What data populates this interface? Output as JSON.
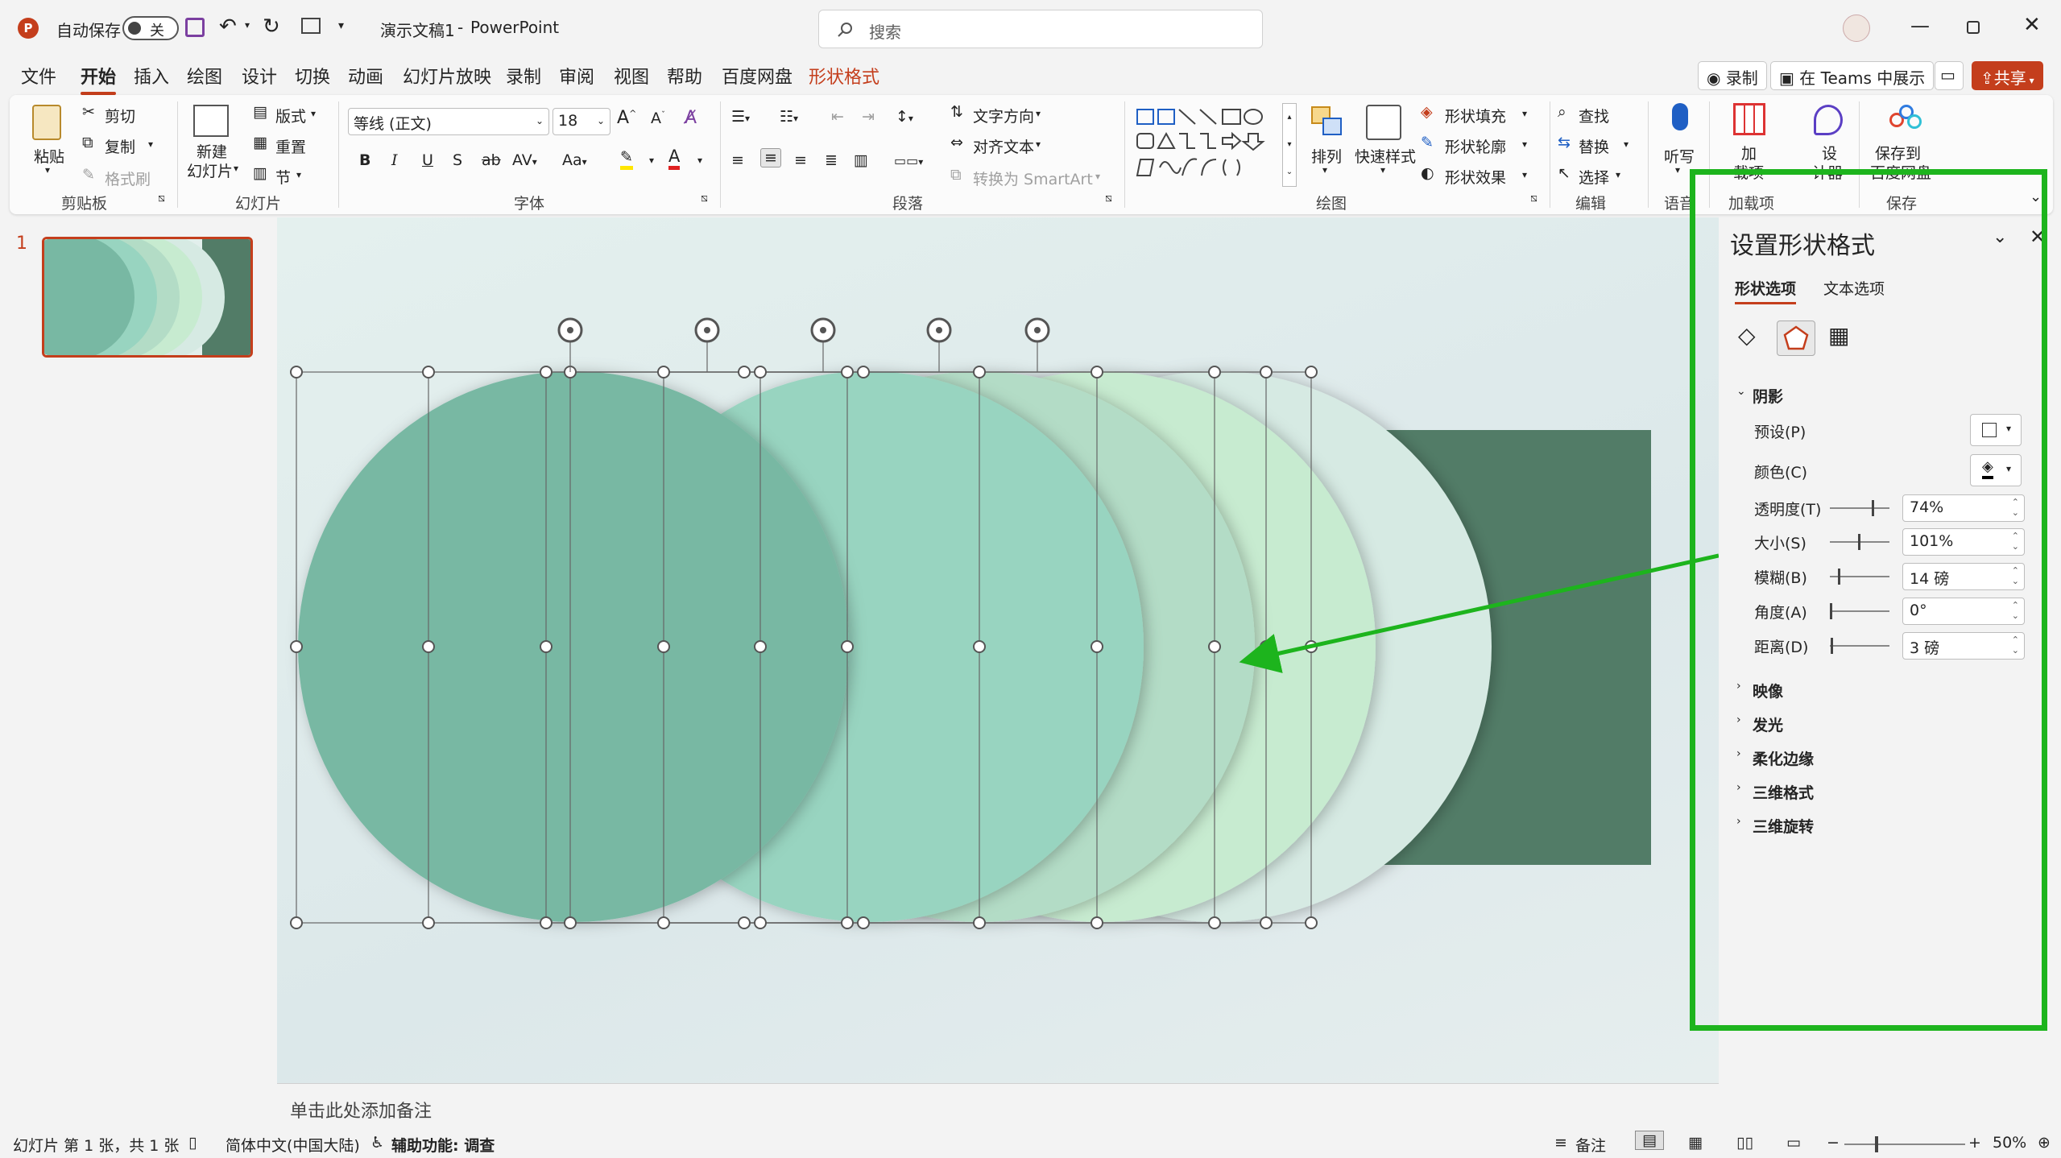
{
  "titlebar": {
    "autosave_label": "自动保存",
    "autosave_state": "关",
    "doc_title": "演示文稿1",
    "separator": "-",
    "app_name": "PowerPoint",
    "search_placeholder": "搜索"
  },
  "menu": {
    "tabs": [
      {
        "label": "文件"
      },
      {
        "label": "开始"
      },
      {
        "label": "插入"
      },
      {
        "label": "绘图"
      },
      {
        "label": "设计"
      },
      {
        "label": "切换"
      },
      {
        "label": "动画"
      },
      {
        "label": "幻灯片放映"
      },
      {
        "label": "录制"
      },
      {
        "label": "审阅"
      },
      {
        "label": "视图"
      },
      {
        "label": "帮助"
      },
      {
        "label": "百度网盘"
      },
      {
        "label": "形状格式"
      }
    ],
    "record_button": "录制",
    "teams_button": "在 Teams 中展示",
    "share_button": "共享"
  },
  "ribbon": {
    "clipboard": {
      "paste": "粘贴",
      "cut": "剪切",
      "copy": "复制",
      "format_painter": "格式刷",
      "group": "剪贴板"
    },
    "slides": {
      "new_slide_line1": "新建",
      "new_slide_line2": "幻灯片",
      "layout": "版式",
      "reset": "重置",
      "section": "节",
      "group": "幻灯片"
    },
    "font": {
      "font_name": "等线 (正文)",
      "font_size": "18",
      "group": "字体"
    },
    "paragraph": {
      "text_direction": "文字方向",
      "align_text": "对齐文本",
      "smartart": "转换为 SmartArt",
      "group": "段落"
    },
    "drawing": {
      "arrange": "排列",
      "quick_styles": "快速样式",
      "shape_fill": "形状填充",
      "shape_outline": "形状轮廓",
      "shape_effects": "形状效果",
      "group": "绘图"
    },
    "editing": {
      "find": "查找",
      "replace": "替换",
      "select": "选择",
      "group": "编辑"
    },
    "voice": {
      "dictate": "听写",
      "group": "语音"
    },
    "addins": {
      "addins_line1": "加",
      "addins_line2": "载项",
      "designer_line1": "设",
      "designer_line2": "计器",
      "group": "加载项"
    },
    "save": {
      "save_baidu_line1": "保存到",
      "save_baidu_line2": "百度网盘",
      "group": "保存"
    }
  },
  "slides_pane": {
    "slide_number": "1"
  },
  "notes": {
    "placeholder": "单击此处添加备注"
  },
  "format_pane": {
    "title": "设置形状格式",
    "tab_shape": "形状选项",
    "tab_text": "文本选项",
    "shadow_section": "阴影",
    "preset_label": "预设(P)",
    "color_label": "颜色(C)",
    "transparency": {
      "label": "透明度(T)",
      "value": "74%",
      "level": 0.74
    },
    "size": {
      "label": "大小(S)",
      "value": "101%",
      "level": 0.5
    },
    "blur": {
      "label": "模糊(B)",
      "value": "14 磅",
      "level": 0.14
    },
    "angle": {
      "label": "角度(A)",
      "value": "0°",
      "level": 0.0
    },
    "distance": {
      "label": "距离(D)",
      "value": "3 磅",
      "level": 0.02
    },
    "collapsed_sections": [
      {
        "label": "映像"
      },
      {
        "label": "发光"
      },
      {
        "label": "柔化边缘"
      },
      {
        "label": "三维格式"
      },
      {
        "label": "三维旋转"
      }
    ]
  },
  "statusbar": {
    "slide_info": "幻灯片 第 1 张，共 1 张",
    "language": "简体中文(中国大陆)",
    "accessibility": "辅助功能: 调查",
    "notes_button": "备注",
    "zoom": "50%"
  },
  "colors": {
    "accent": "#c43e1c",
    "highlight_box": "#1db41d",
    "circle1": "#78b8a3",
    "circle2": "#98d4c0",
    "circle3": "#b3dcc6",
    "circle4": "#c7ebd0",
    "circle5": "#d6eae3",
    "rect": "#527c67"
  }
}
